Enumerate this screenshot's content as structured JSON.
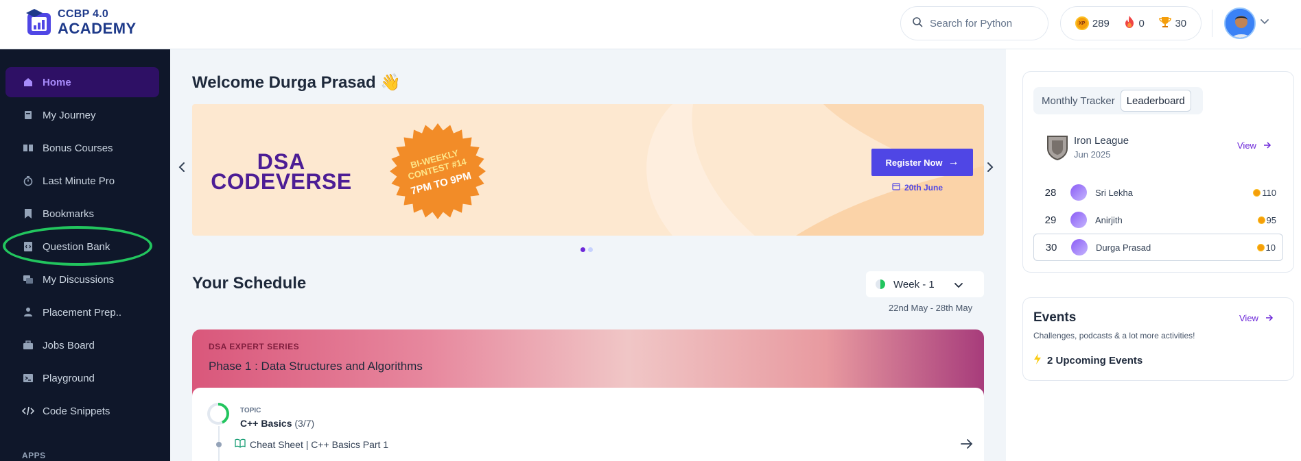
{
  "brand": {
    "line1": "CCBP 4.0",
    "line2": "ACADEMY"
  },
  "search": {
    "placeholder": "Search for Python"
  },
  "stats": {
    "xp_badge": "XP",
    "xp": "289",
    "streak": "0",
    "trophies": "30"
  },
  "sidebar": {
    "items": [
      {
        "label": "Home",
        "icon": "home-icon",
        "active": true
      },
      {
        "label": "My Journey",
        "icon": "journey-icon"
      },
      {
        "label": "Bonus Courses",
        "icon": "book-open-icon"
      },
      {
        "label": "Last Minute Pro",
        "icon": "stopwatch-icon"
      },
      {
        "label": "Bookmarks",
        "icon": "bookmark-icon"
      },
      {
        "label": "Question Bank",
        "icon": "code-file-icon"
      },
      {
        "label": "My Discussions",
        "icon": "chat-icon"
      },
      {
        "label": "Placement Prep..",
        "icon": "placement-icon"
      },
      {
        "label": "Jobs Board",
        "icon": "briefcase-icon"
      },
      {
        "label": "Playground",
        "icon": "terminal-icon"
      },
      {
        "label": "Code Snippets",
        "icon": "code-icon"
      }
    ],
    "section_apps": "APPS"
  },
  "main": {
    "welcome": "Welcome Durga Prasad",
    "welcome_emoji": "👋",
    "banner": {
      "title_line1": "DSA",
      "title_line2": "CODEVERSE",
      "badge_line1": "BI-WEEKLY",
      "badge_line2": "CONTEST #14",
      "badge_time": "7PM TO 9PM",
      "cta": "Register Now",
      "date": "20th June"
    },
    "schedule_title": "Your Schedule",
    "week_label": "Week - 1",
    "week_range": "22nd May - 28th May",
    "series": {
      "tag": "DSA EXPERT SERIES",
      "title": "Phase 1 : Data Structures and Algorithms"
    },
    "topic": {
      "label": "TOPIC",
      "name": "C++ Basics",
      "count": "(3/7)",
      "progress": 0.43,
      "item": "Cheat Sheet | C++ Basics Part 1"
    }
  },
  "tracker": {
    "tabs": [
      "Monthly Tracker",
      "Leaderboard"
    ],
    "active_tab": "Leaderboard",
    "league": {
      "name": "Iron League",
      "date": "Jun 2025",
      "view": "View"
    },
    "rows": [
      {
        "rank": "28",
        "name": "Sri Lekha",
        "coins": "110"
      },
      {
        "rank": "29",
        "name": "Anirjith",
        "coins": "95"
      },
      {
        "rank": "30",
        "name": "Durga Prasad",
        "coins": "10",
        "me": true
      }
    ]
  },
  "events": {
    "title": "Events",
    "view": "View",
    "subtitle": "Challenges, podcasts & a lot more activities!",
    "upcoming": "2 Upcoming Events"
  },
  "colors": {
    "accent": "#4f46e5",
    "sidebar_bg": "#0f172a",
    "active_nav_bg": "#2e1065",
    "highlight_ring": "#22c55e"
  }
}
